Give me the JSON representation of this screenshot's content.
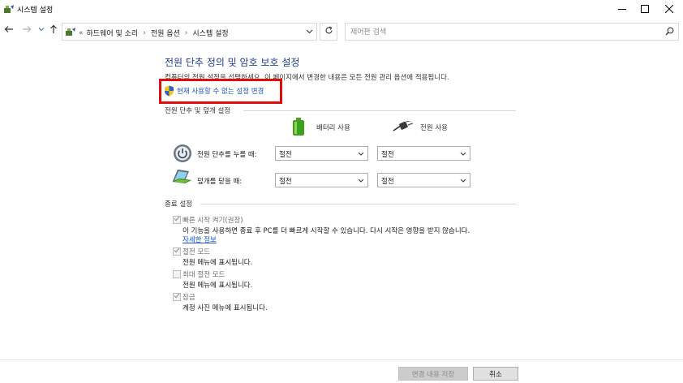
{
  "window": {
    "title": "시스템 설정",
    "app_icon": "power-options-icon",
    "controls": [
      "minimize-icon",
      "maximize-icon",
      "close-icon"
    ]
  },
  "navigation": {
    "back_icon": "back-arrow-icon",
    "forward_icon": "forward-arrow-icon",
    "recent_icon": "chevron-down-icon",
    "up_icon": "up-arrow-icon",
    "breadcrumb_prefix": "«",
    "breadcrumbs": [
      "하드웨어 및 소리",
      "전원 옵션",
      "시스템 설정"
    ],
    "refresh_icon": "refresh-icon",
    "search_placeholder": "제어판 검색"
  },
  "main": {
    "heading": "전원 단추 정의 및 암호 보호 설정",
    "description": "컴퓨터의 전원 설정을 선택하세요. 이 페이지에서 변경한 내용은 모든 전원 관리 옵션에 적용됩니다.",
    "uac_link": "현재 사용할 수 없는 설정 변경",
    "power_section": {
      "label": "전원 단추 및 덮개 설정",
      "columns": {
        "battery": "배터리 사용",
        "plugged_in": "전원 사용"
      },
      "rows": [
        {
          "label": "전원 단추를 누를 때:",
          "battery": "절전",
          "plugged_in": "절전",
          "icon": "power-button-icon"
        },
        {
          "label": "덮개를 닫을 때:",
          "battery": "절전",
          "plugged_in": "절전",
          "icon": "laptop-lid-icon"
        }
      ]
    },
    "shutdown_section": {
      "label": "종료 설정",
      "items": [
        {
          "label": "빠른 시작 켜기(권장)",
          "checked": true,
          "description": "이 기능을 사용하면 종료 후 PC를 더 빠르게 시작할 수 있습니다. 다시 시작은 영향을 받지 않습니다.",
          "link": "자세한 정보"
        },
        {
          "label": "절전 모드",
          "checked": true,
          "description": "전원 메뉴에 표시됩니다."
        },
        {
          "label": "최대 절전 모드",
          "checked": false,
          "description": "전원 메뉴에 표시됩니다."
        },
        {
          "label": "잠금",
          "checked": true,
          "description": "계정 사진 메뉴에 표시됩니다."
        }
      ]
    }
  },
  "footer": {
    "save_label": "변경 내용 저장",
    "cancel_label": "취소"
  },
  "colors": {
    "heading": "#1e3c8c",
    "link": "#1a55c8",
    "highlight_border": "#e00d0d"
  }
}
